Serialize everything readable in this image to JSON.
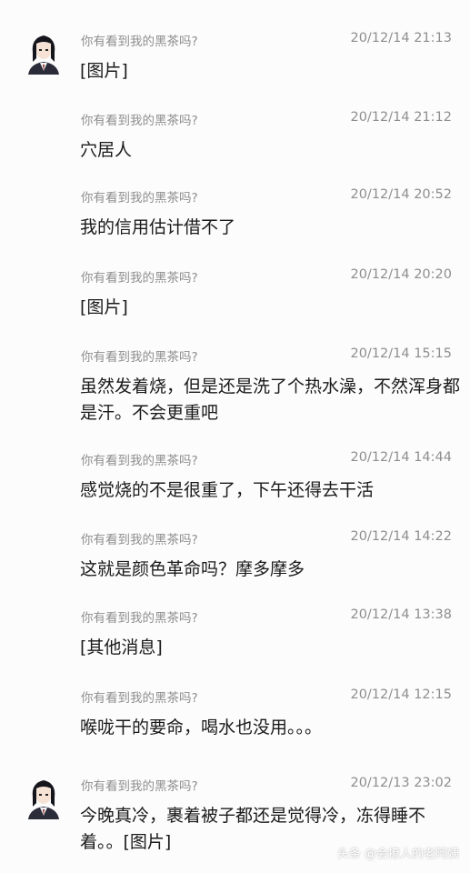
{
  "messages": [
    {
      "sender": "你有看到我的黑茶吗?",
      "time": "20/12/14 21:13",
      "text": "[图片]",
      "show_avatar": true
    },
    {
      "sender": "你有看到我的黑茶吗?",
      "time": "20/12/14 21:12",
      "text": "穴居人",
      "show_avatar": false
    },
    {
      "sender": "你有看到我的黑茶吗?",
      "time": "20/12/14 20:52",
      "text": "我的信用估计借不了",
      "show_avatar": false
    },
    {
      "sender": "你有看到我的黑茶吗?",
      "time": "20/12/14 20:20",
      "text": "[图片]",
      "show_avatar": false
    },
    {
      "sender": "你有看到我的黑茶吗?",
      "time": "20/12/14 15:15",
      "text": "虽然发着烧，但是还是洗了个热水澡，不然浑身都是汗。不会更重吧",
      "show_avatar": false
    },
    {
      "sender": "你有看到我的黑茶吗?",
      "time": "20/12/14 14:44",
      "text": "感觉烧的不是很重了，下午还得去干活",
      "show_avatar": false
    },
    {
      "sender": "你有看到我的黑茶吗?",
      "time": "20/12/14 14:22",
      "text": "这就是颜色革命吗？摩多摩多",
      "show_avatar": false
    },
    {
      "sender": "你有看到我的黑茶吗?",
      "time": "20/12/14 13:38",
      "text": "[其他消息]",
      "show_avatar": false
    },
    {
      "sender": "你有看到我的黑茶吗?",
      "time": "20/12/14 12:15",
      "text": "喉咙干的要命，喝水也没用。。。",
      "show_avatar": false
    },
    {
      "sender": "你有看到我的黑茶吗?",
      "time": "20/12/13 23:02",
      "text": "今晚真冷，裹着被子都还是觉得冷，冻得睡不着。。[图片]",
      "show_avatar": true
    }
  ],
  "watermark": "头条 @会撩人的老阿姨",
  "colors": {
    "meta": "#8e8e8e",
    "text": "#1a1a1a",
    "background": "#fcfcfc"
  }
}
